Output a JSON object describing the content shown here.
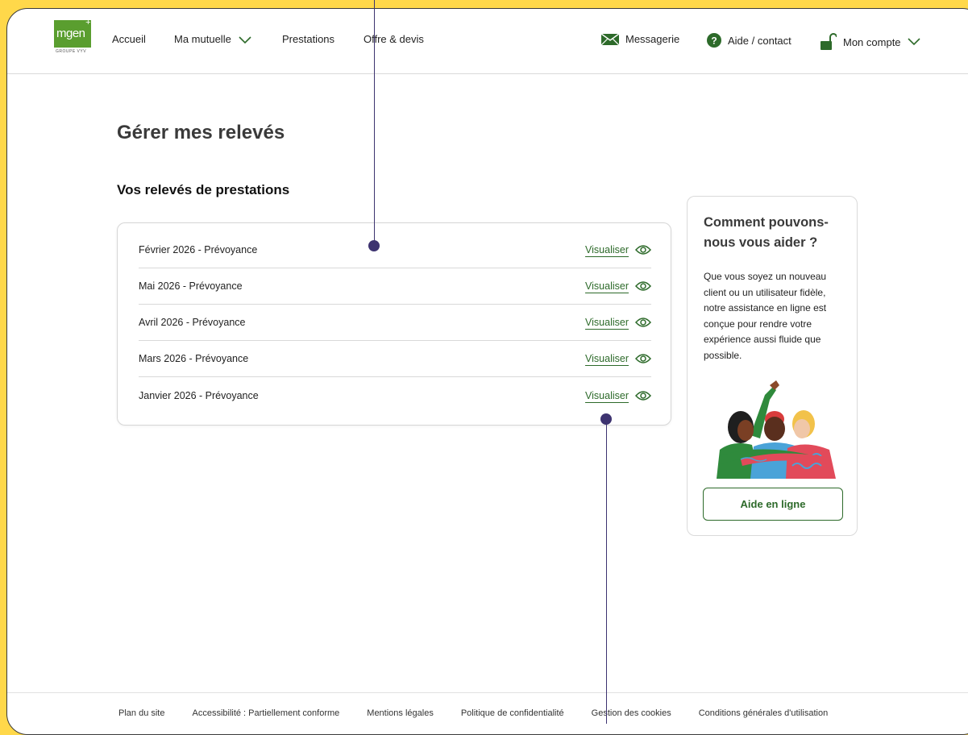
{
  "header": {
    "logo_text": "mgen",
    "logo_sub": "GROUPE VYV",
    "nav": [
      "Accueil",
      "Ma mutuelle",
      "Prestations",
      "Offre & devis"
    ],
    "messagerie": "Messagerie",
    "aide_contact": "Aide / contact",
    "mon_compte": "Mon compte"
  },
  "main": {
    "page_title": "Gérer mes relevés",
    "section_title": "Vos relevés de prestations",
    "view_label": "Visualiser",
    "statements": [
      "Février  2026 - Prévoyance",
      "Mai 2026 - Prévoyance",
      "Avril 2026 - Prévoyance",
      "Mars 2026 - Prévoyance",
      "Janvier 2026 - Prévoyance"
    ]
  },
  "help": {
    "title": "Comment pouvons-nous vous aider ?",
    "text": "Que vous soyez un nouveau client ou un utilisateur fidèle, notre assistance en ligne est conçue pour rendre votre expérience aussi fluide que possible.",
    "button": "Aide en ligne"
  },
  "footer": {
    "links": [
      "Plan du site",
      "Accessibilité : Partiellement conforme",
      "Mentions légales",
      "Politique de confidentialité",
      "Gestion des cookies",
      "Conditions générales d'utilisation"
    ]
  },
  "colors": {
    "background": "#ffd84a",
    "accent_green": "#2d6a2a",
    "logo_green": "#5a9e2f",
    "annotation": "#3d3370"
  }
}
